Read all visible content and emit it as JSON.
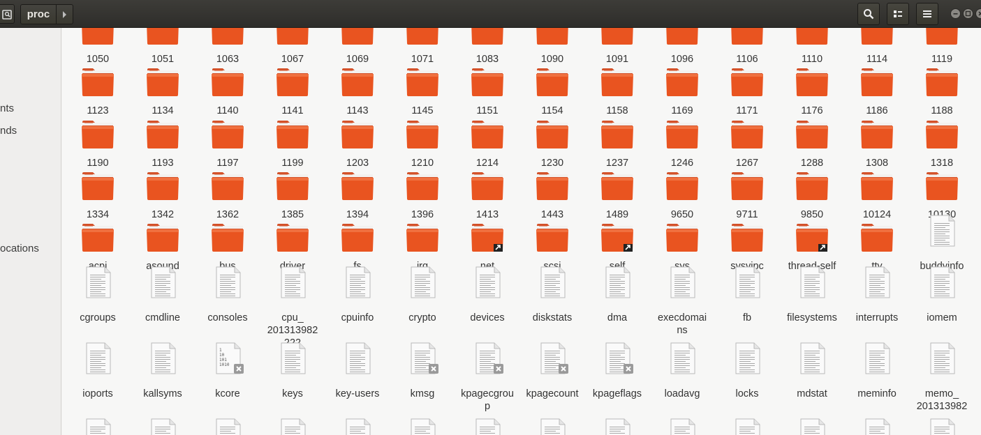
{
  "window": {
    "location_label": "proc"
  },
  "sidebar": {
    "items": [
      {
        "label": "nts"
      },
      {
        "label": "nds"
      },
      {
        "label": "ocations"
      }
    ]
  },
  "files": [
    {
      "name": "1050",
      "type": "folder"
    },
    {
      "name": "1051",
      "type": "folder"
    },
    {
      "name": "1063",
      "type": "folder"
    },
    {
      "name": "1067",
      "type": "folder"
    },
    {
      "name": "1069",
      "type": "folder"
    },
    {
      "name": "1071",
      "type": "folder"
    },
    {
      "name": "1083",
      "type": "folder"
    },
    {
      "name": "1090",
      "type": "folder"
    },
    {
      "name": "1091",
      "type": "folder"
    },
    {
      "name": "1096",
      "type": "folder"
    },
    {
      "name": "1106",
      "type": "folder"
    },
    {
      "name": "1110",
      "type": "folder"
    },
    {
      "name": "1114",
      "type": "folder"
    },
    {
      "name": "1119",
      "type": "folder"
    },
    {
      "name": "1123",
      "type": "folder"
    },
    {
      "name": "1134",
      "type": "folder"
    },
    {
      "name": "1140",
      "type": "folder"
    },
    {
      "name": "1141",
      "type": "folder"
    },
    {
      "name": "1143",
      "type": "folder"
    },
    {
      "name": "1145",
      "type": "folder"
    },
    {
      "name": "1151",
      "type": "folder"
    },
    {
      "name": "1154",
      "type": "folder"
    },
    {
      "name": "1158",
      "type": "folder"
    },
    {
      "name": "1169",
      "type": "folder"
    },
    {
      "name": "1171",
      "type": "folder"
    },
    {
      "name": "1176",
      "type": "folder"
    },
    {
      "name": "1186",
      "type": "folder"
    },
    {
      "name": "1188",
      "type": "folder"
    },
    {
      "name": "1190",
      "type": "folder"
    },
    {
      "name": "1193",
      "type": "folder"
    },
    {
      "name": "1197",
      "type": "folder"
    },
    {
      "name": "1199",
      "type": "folder"
    },
    {
      "name": "1203",
      "type": "folder"
    },
    {
      "name": "1210",
      "type": "folder"
    },
    {
      "name": "1214",
      "type": "folder"
    },
    {
      "name": "1230",
      "type": "folder"
    },
    {
      "name": "1237",
      "type": "folder"
    },
    {
      "name": "1246",
      "type": "folder"
    },
    {
      "name": "1267",
      "type": "folder"
    },
    {
      "name": "1288",
      "type": "folder"
    },
    {
      "name": "1308",
      "type": "folder"
    },
    {
      "name": "1318",
      "type": "folder"
    },
    {
      "name": "1334",
      "type": "folder"
    },
    {
      "name": "1342",
      "type": "folder"
    },
    {
      "name": "1362",
      "type": "folder"
    },
    {
      "name": "1385",
      "type": "folder"
    },
    {
      "name": "1394",
      "type": "folder"
    },
    {
      "name": "1396",
      "type": "folder"
    },
    {
      "name": "1413",
      "type": "folder"
    },
    {
      "name": "1443",
      "type": "folder"
    },
    {
      "name": "1489",
      "type": "folder"
    },
    {
      "name": "9650",
      "type": "folder"
    },
    {
      "name": "9711",
      "type": "folder"
    },
    {
      "name": "9850",
      "type": "folder"
    },
    {
      "name": "10124",
      "type": "folder"
    },
    {
      "name": "10130",
      "type": "folder"
    },
    {
      "name": "acpi",
      "type": "folder"
    },
    {
      "name": "asound",
      "type": "folder"
    },
    {
      "name": "bus",
      "type": "folder"
    },
    {
      "name": "driver",
      "type": "folder"
    },
    {
      "name": "fs",
      "type": "folder"
    },
    {
      "name": "irq",
      "type": "folder"
    },
    {
      "name": "net",
      "type": "folder",
      "symlink": true
    },
    {
      "name": "scsi",
      "type": "folder"
    },
    {
      "name": "self",
      "type": "folder",
      "symlink": true
    },
    {
      "name": "sys",
      "type": "folder"
    },
    {
      "name": "sysvipc",
      "type": "folder"
    },
    {
      "name": "thread-self",
      "type": "folder",
      "symlink": true
    },
    {
      "name": "tty",
      "type": "folder"
    },
    {
      "name": "buddyinfo",
      "type": "text"
    },
    {
      "name": "cgroups",
      "type": "text"
    },
    {
      "name": "cmdline",
      "type": "text"
    },
    {
      "name": "consoles",
      "type": "text"
    },
    {
      "name": "cpu_201313982222",
      "type": "text",
      "lines": [
        "cpu_",
        "201313982",
        "222"
      ]
    },
    {
      "name": "cpuinfo",
      "type": "text"
    },
    {
      "name": "crypto",
      "type": "text"
    },
    {
      "name": "devices",
      "type": "text"
    },
    {
      "name": "diskstats",
      "type": "text"
    },
    {
      "name": "dma",
      "type": "text"
    },
    {
      "name": "execdomains",
      "type": "text",
      "lines": [
        "execdomai",
        "ns"
      ]
    },
    {
      "name": "fb",
      "type": "text"
    },
    {
      "name": "filesystems",
      "type": "text"
    },
    {
      "name": "interrupts",
      "type": "text"
    },
    {
      "name": "iomem",
      "type": "text"
    },
    {
      "name": "ioports",
      "type": "text"
    },
    {
      "name": "kallsyms",
      "type": "text"
    },
    {
      "name": "kcore",
      "type": "binary",
      "locked": true
    },
    {
      "name": "keys",
      "type": "text"
    },
    {
      "name": "key-users",
      "type": "text"
    },
    {
      "name": "kmsg",
      "type": "text",
      "locked": true
    },
    {
      "name": "kpagecgroup",
      "type": "text",
      "locked": true,
      "lines": [
        "kpagecgrou",
        "p"
      ]
    },
    {
      "name": "kpagecount",
      "type": "text",
      "locked": true
    },
    {
      "name": "kpageflags",
      "type": "text",
      "locked": true
    },
    {
      "name": "loadavg",
      "type": "text"
    },
    {
      "name": "locks",
      "type": "text"
    },
    {
      "name": "mdstat",
      "type": "text"
    },
    {
      "name": "meminfo",
      "type": "text"
    },
    {
      "name": "memo_201313982",
      "type": "text",
      "lines": [
        "memo_",
        "201313982"
      ]
    },
    {
      "name": "",
      "type": "text"
    },
    {
      "name": "",
      "type": "text"
    },
    {
      "name": "",
      "type": "text",
      "locked": true
    },
    {
      "name": "",
      "type": "text"
    },
    {
      "name": "",
      "type": "text"
    },
    {
      "name": "",
      "type": "text"
    },
    {
      "name": "",
      "type": "text"
    },
    {
      "name": "",
      "type": "text"
    },
    {
      "name": "",
      "type": "text",
      "locked": true
    },
    {
      "name": "",
      "type": "text"
    },
    {
      "name": "",
      "type": "text"
    },
    {
      "name": "",
      "type": "text"
    },
    {
      "name": "",
      "type": "text",
      "locked": true
    },
    {
      "name": "",
      "type": "text",
      "locked": true
    }
  ],
  "colors": {
    "folder": "#e95420",
    "folder_tab": "#d4522a",
    "accent": "#e95420"
  }
}
